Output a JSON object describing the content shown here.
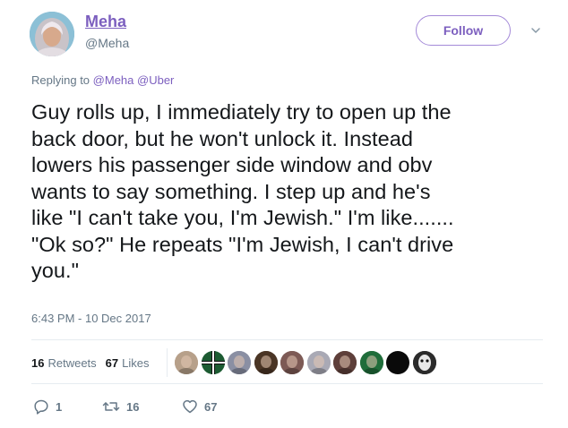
{
  "author": {
    "display_name": "Meha",
    "handle": "@Meha"
  },
  "follow_label": "Follow",
  "reply_context": {
    "prefix": "Replying to",
    "mentions": [
      "@Meha",
      "@Uber"
    ]
  },
  "tweet_text": "Guy rolls up, I immediately try to open up the\nback door, but he won't unlock it. Instead\nlowers his passenger side window and obv\nwants to say something. I step up and he's\nlike \"I can't take you, I'm Jewish.\" I'm like.......\n\"Ok so?\" He repeats \"I'm Jewish, I can't drive\nyou.\"",
  "timestamp": "6:43 PM - 10 Dec 2017",
  "stats": {
    "retweets_count": "16",
    "retweets_label": "Retweets",
    "likes_count": "67",
    "likes_label": "Likes"
  },
  "actions": {
    "reply_count": "1",
    "retweet_count": "16",
    "like_count": "67"
  },
  "colors": {
    "accent": "#7c5fbf",
    "secondary_text": "#657786",
    "divider": "#e6ecf0"
  },
  "liker_avatars": [
    {
      "name": "liker-avatar-1",
      "color": "#b7a08a"
    },
    {
      "name": "liker-avatar-2",
      "color": "#1c5b32"
    },
    {
      "name": "liker-avatar-3",
      "color": "#8a8fa3"
    },
    {
      "name": "liker-avatar-4",
      "color": "#4a3525"
    },
    {
      "name": "liker-avatar-5",
      "color": "#7d5a55"
    },
    {
      "name": "liker-avatar-6",
      "color": "#a9a9b5"
    },
    {
      "name": "liker-avatar-7",
      "color": "#5e3f3a"
    },
    {
      "name": "liker-avatar-8",
      "color": "#1f6d3a"
    },
    {
      "name": "liker-avatar-9",
      "color": "#0a0a0a"
    },
    {
      "name": "liker-avatar-10",
      "color": "#2b2b2b"
    }
  ]
}
